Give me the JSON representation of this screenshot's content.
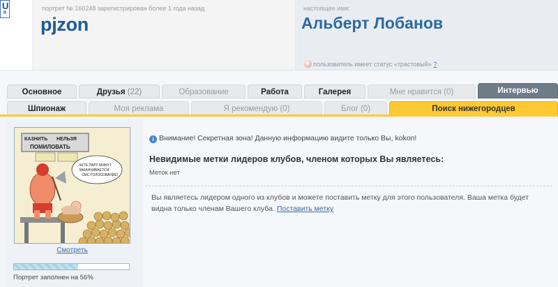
{
  "header": {
    "portrait_info": "портрет № 160248 зарегистрирован более 1 года назад",
    "nickname": "pjzon",
    "real_name_label": "настоящее имя:",
    "real_name": "Альберт Лобанов",
    "trust_status": "пользователь имеет статус «трастовый»",
    "trust_help": "?"
  },
  "tabs_row1": [
    {
      "label": "Основное",
      "count": ""
    },
    {
      "label": "Друзья",
      "count": "(22)"
    },
    {
      "label": "Образование",
      "count": ""
    },
    {
      "label": "Работа",
      "count": ""
    },
    {
      "label": "Галерея",
      "count": ""
    },
    {
      "label": "Мне нравится (0)",
      "count": ""
    },
    {
      "label": "Интервью",
      "count": ""
    }
  ],
  "tabs_row2": [
    {
      "label": "Шпионаж"
    },
    {
      "label": "Моя реклама"
    },
    {
      "label": "Я рекомендую (0)"
    },
    {
      "label": "Блог (0)"
    },
    {
      "label": "Поиск нижегородцев"
    }
  ],
  "left": {
    "view_link": "Смотреть",
    "progress_text": "Портрет заполнен на 56%",
    "progress_value": 0.56,
    "cartoon_labels": [
      "КАЗНИТЬ",
      "НЕЛЬЗЯ",
      "ПОМИЛОВАТЬ",
      "ЧЕТЕ ПАРУ МИНУТ ЗАКАНЧИВАЕТСЯ СМС-ГОЛОСОВАНИЕ!"
    ]
  },
  "main": {
    "warning": "Внимание! Секретная зона! Данную информацию видите только Вы, kokon!",
    "marks_heading": "Невидимые метки лидеров клубов, членом которых Вы являетесь:",
    "no_marks": "Меток нет",
    "leader_text": "Вы являетесь лидером одного из клубов и можете поставить метку для этого пользователя. Ваша метка будет видна только членам Вашего клуба.",
    "set_mark_link": "Поставить метку"
  },
  "colors": {
    "accent_orange": "#ffc933",
    "active_tab": "#6e7c88",
    "link": "#3a6aa3"
  }
}
